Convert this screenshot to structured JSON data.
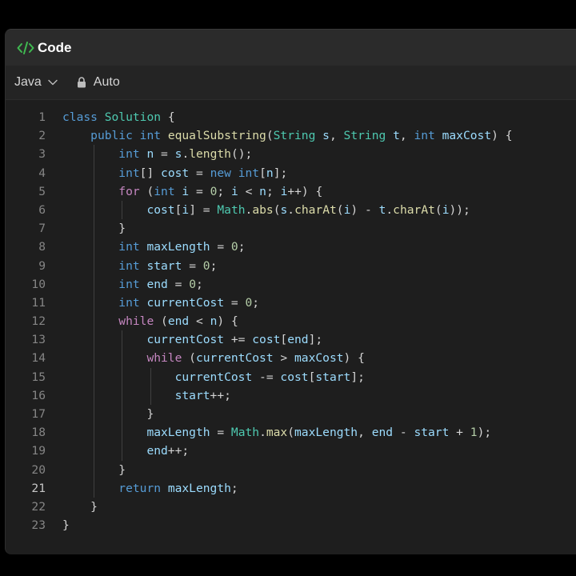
{
  "panel": {
    "title": "Code",
    "title_icon": "code-brackets-icon",
    "language": "Java",
    "mode": "Auto"
  },
  "editor": {
    "active_line": 21,
    "lines": [
      "class Solution {",
      "    public int equalSubstring(String s, String t, int maxCost) {",
      "        int n = s.length();",
      "        int[] cost = new int[n];",
      "        for (int i = 0; i < n; i++) {",
      "            cost[i] = Math.abs(s.charAt(i) - t.charAt(i));",
      "        }",
      "        int maxLength = 0;",
      "        int start = 0;",
      "        int end = 0;",
      "        int currentCost = 0;",
      "        while (end < n) {",
      "            currentCost += cost[end];",
      "            while (currentCost > maxCost) {",
      "                currentCost -= cost[start];",
      "                start++;",
      "            }",
      "            maxLength = Math.max(maxLength, end - start + 1);",
      "            end++;",
      "        }",
      "        return maxLength;",
      "    }",
      "}"
    ]
  }
}
